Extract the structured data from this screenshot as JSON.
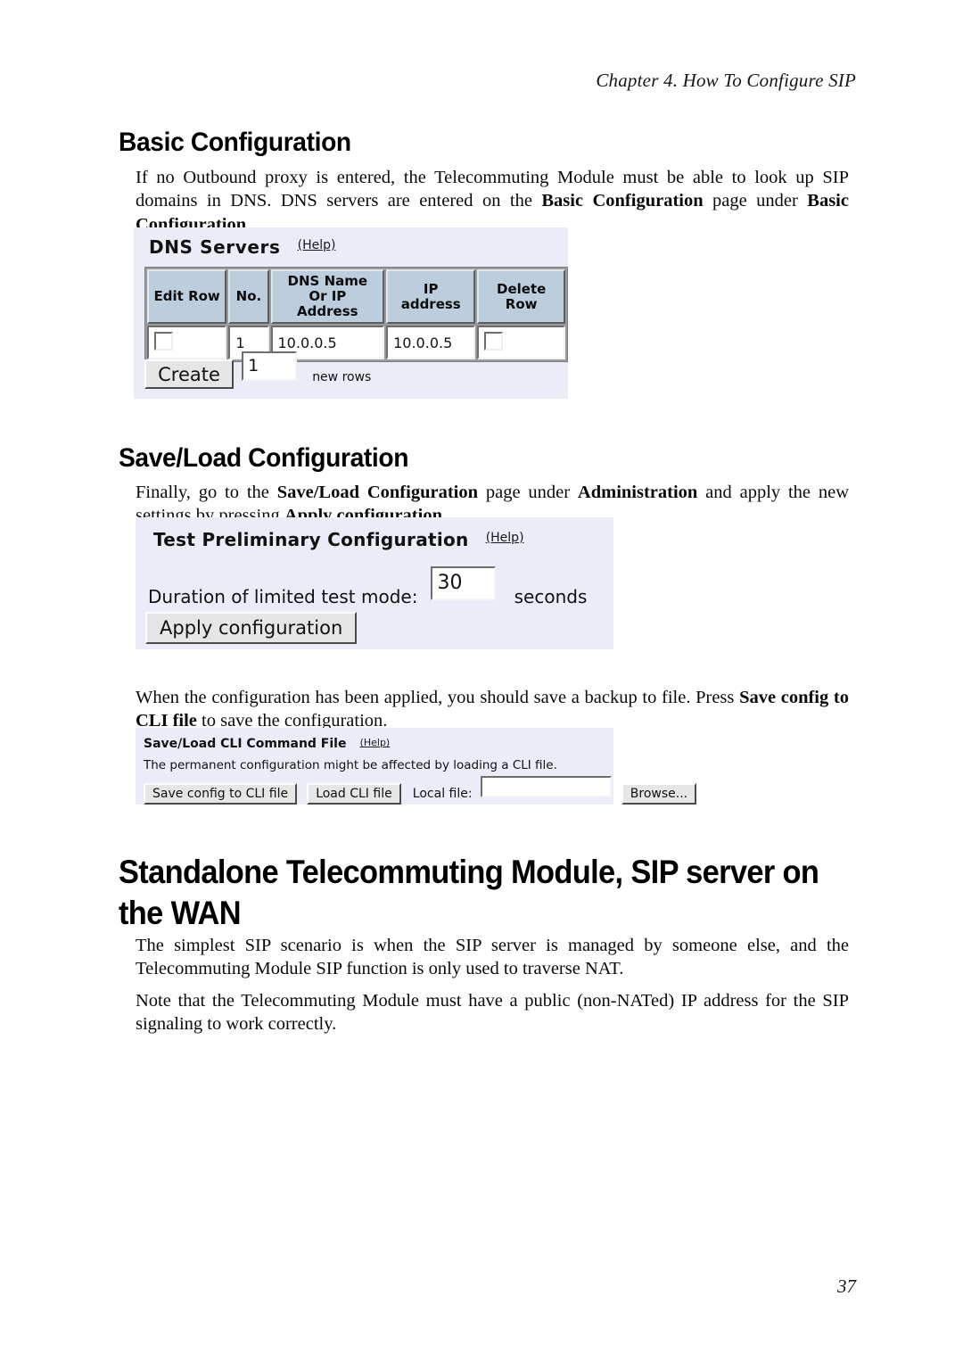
{
  "header": {
    "running_head": "Chapter 4. How To Configure SIP"
  },
  "sections": {
    "basic_configuration": {
      "heading": "Basic Configuration",
      "paragraph_html": "If no Outbound proxy is entered, the Telecommuting Module must be able to look up SIP domains in DNS. DNS servers are entered on the <b>Basic Configuration</b> page under <b>Basic Configuration</b>."
    },
    "save_load_configuration": {
      "heading": "Save/Load Configuration",
      "paragraph_html": "Finally, go to the <b>Save/Load Configuration</b> page under <b>Administration</b> and apply the new settings by pressing <b>Apply configuration</b>.",
      "paragraph2_html": "When the configuration has been applied, you should save a backup to file. Press <b>Save config to CLI file</b> to save the configuration."
    },
    "standalone": {
      "heading": "Standalone Telecommuting Module, SIP server on the WAN",
      "paragraph1": "The simplest SIP scenario is when the SIP server is managed by someone else, and the Telecommuting Module SIP function is only used to traverse NAT.",
      "paragraph2": "Note that the Telecommuting Module must have a public (non-NATed) IP address for the SIP signaling to work correctly."
    }
  },
  "screenshots": {
    "dns_servers": {
      "title": "DNS Servers",
      "help_label": "(Help)",
      "columns": [
        "Edit Row",
        "No.",
        "DNS Name\nOr IP Address",
        "IP address",
        "Delete Row"
      ],
      "rows": [
        {
          "edit_row_checked": false,
          "no": "1",
          "dns_name_or_ip": "10.0.0.5",
          "ip_address": "10.0.0.5",
          "delete_row_checked": false
        }
      ],
      "create_button": "Create",
      "create_count": "1",
      "create_suffix": "new rows"
    },
    "test_preliminary": {
      "title": "Test Preliminary Configuration",
      "help_label": "(Help)",
      "duration_label": "Duration of limited test mode:",
      "duration_value": "30",
      "duration_unit": "seconds",
      "apply_button": "Apply configuration"
    },
    "cli_command_file": {
      "title": "Save/Load CLI Command File",
      "help_label": "(Help)",
      "warning": "The permanent configuration might be affected by loading a CLI file.",
      "save_button": "Save config to CLI file",
      "load_button": "Load CLI file",
      "local_file_label": "Local file:",
      "local_file_value": "",
      "browse_button": "Browse..."
    }
  },
  "footer": {
    "page_number": "37"
  },
  "colors": {
    "panel_background": "#eaecf7",
    "table_header": "#bccedd",
    "button_face": "#e6e6e6",
    "text": "#111111"
  }
}
